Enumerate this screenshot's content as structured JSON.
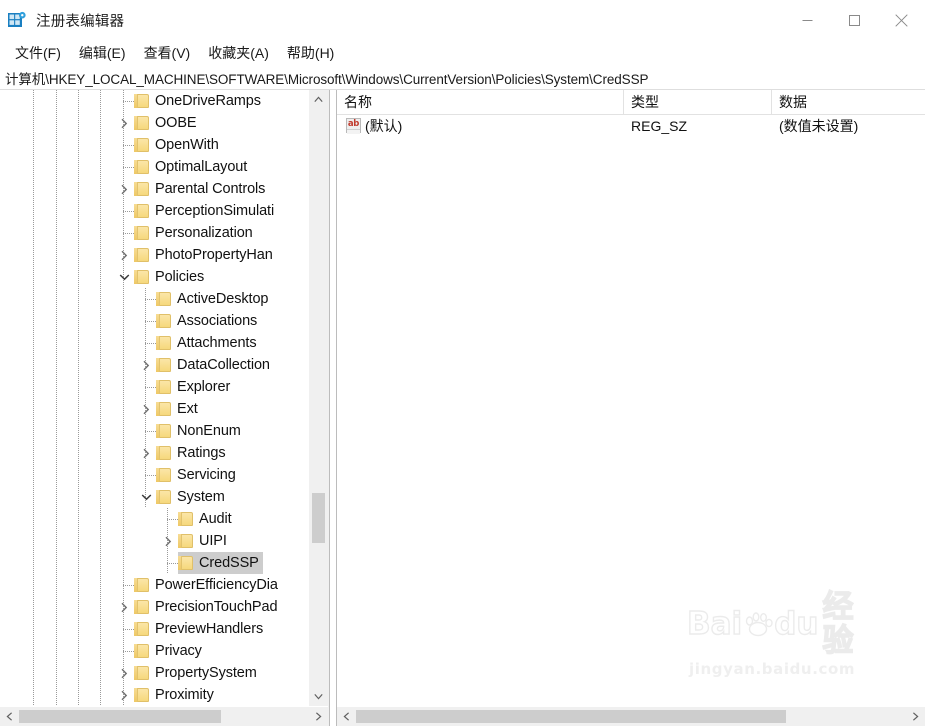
{
  "window": {
    "title": "注册表编辑器",
    "app_icon": "registry-editor-icon",
    "minimize_label": "最小化",
    "maximize_label": "最大化",
    "close_label": "关闭"
  },
  "menubar": {
    "items": [
      {
        "label": "文件(F)",
        "name": "menu-file"
      },
      {
        "label": "编辑(E)",
        "name": "menu-edit"
      },
      {
        "label": "查看(V)",
        "name": "menu-view"
      },
      {
        "label": "收藏夹(A)",
        "name": "menu-favorites"
      },
      {
        "label": "帮助(H)",
        "name": "menu-help"
      }
    ]
  },
  "address": {
    "path": "计算机\\HKEY_LOCAL_MACHINE\\SOFTWARE\\Microsoft\\Windows\\CurrentVersion\\Policies\\System\\CredSSP"
  },
  "tree": {
    "rows": [
      {
        "label": "OneDriveRamps",
        "indent": 5,
        "twisty": "none",
        "selected": false
      },
      {
        "label": "OOBE",
        "indent": 5,
        "twisty": "collapsed",
        "selected": false
      },
      {
        "label": "OpenWith",
        "indent": 5,
        "twisty": "none",
        "selected": false
      },
      {
        "label": "OptimalLayout",
        "indent": 5,
        "twisty": "none",
        "selected": false
      },
      {
        "label": "Parental Controls",
        "indent": 5,
        "twisty": "collapsed",
        "selected": false
      },
      {
        "label": "PerceptionSimulati",
        "indent": 5,
        "twisty": "none",
        "selected": false
      },
      {
        "label": "Personalization",
        "indent": 5,
        "twisty": "none",
        "selected": false
      },
      {
        "label": "PhotoPropertyHan",
        "indent": 5,
        "twisty": "collapsed",
        "selected": false
      },
      {
        "label": "Policies",
        "indent": 5,
        "twisty": "expanded",
        "selected": false
      },
      {
        "label": "ActiveDesktop",
        "indent": 6,
        "twisty": "none",
        "selected": false
      },
      {
        "label": "Associations",
        "indent": 6,
        "twisty": "none",
        "selected": false
      },
      {
        "label": "Attachments",
        "indent": 6,
        "twisty": "none",
        "selected": false
      },
      {
        "label": "DataCollection",
        "indent": 6,
        "twisty": "collapsed",
        "selected": false
      },
      {
        "label": "Explorer",
        "indent": 6,
        "twisty": "none",
        "selected": false
      },
      {
        "label": "Ext",
        "indent": 6,
        "twisty": "collapsed",
        "selected": false
      },
      {
        "label": "NonEnum",
        "indent": 6,
        "twisty": "none",
        "selected": false
      },
      {
        "label": "Ratings",
        "indent": 6,
        "twisty": "collapsed",
        "selected": false
      },
      {
        "label": "Servicing",
        "indent": 6,
        "twisty": "none",
        "selected": false
      },
      {
        "label": "System",
        "indent": 6,
        "twisty": "expanded",
        "selected": false
      },
      {
        "label": "Audit",
        "indent": 7,
        "twisty": "none",
        "selected": false
      },
      {
        "label": "UIPI",
        "indent": 7,
        "twisty": "collapsed",
        "selected": false
      },
      {
        "label": "CredSSP",
        "indent": 7,
        "twisty": "none",
        "selected": true
      },
      {
        "label": "PowerEfficiencyDia",
        "indent": 5,
        "twisty": "none",
        "selected": false
      },
      {
        "label": "PrecisionTouchPad",
        "indent": 5,
        "twisty": "collapsed",
        "selected": false
      },
      {
        "label": "PreviewHandlers",
        "indent": 5,
        "twisty": "none",
        "selected": false
      },
      {
        "label": "Privacy",
        "indent": 5,
        "twisty": "none",
        "selected": false
      },
      {
        "label": "PropertySystem",
        "indent": 5,
        "twisty": "collapsed",
        "selected": false
      },
      {
        "label": "Proximity",
        "indent": 5,
        "twisty": "collapsed",
        "selected": false
      }
    ]
  },
  "listview": {
    "columns": [
      {
        "label": "名称",
        "name": "column-name"
      },
      {
        "label": "类型",
        "name": "column-type"
      },
      {
        "label": "数据",
        "name": "column-data"
      }
    ],
    "rows": [
      {
        "icon": "string-value-icon",
        "name": "(默认)",
        "type": "REG_SZ",
        "data": "(数值未设置)"
      }
    ]
  },
  "watermark": {
    "brand": "Bai",
    "brand2": "du",
    "cn": "经验",
    "site": "jingyan.baidu.com"
  }
}
